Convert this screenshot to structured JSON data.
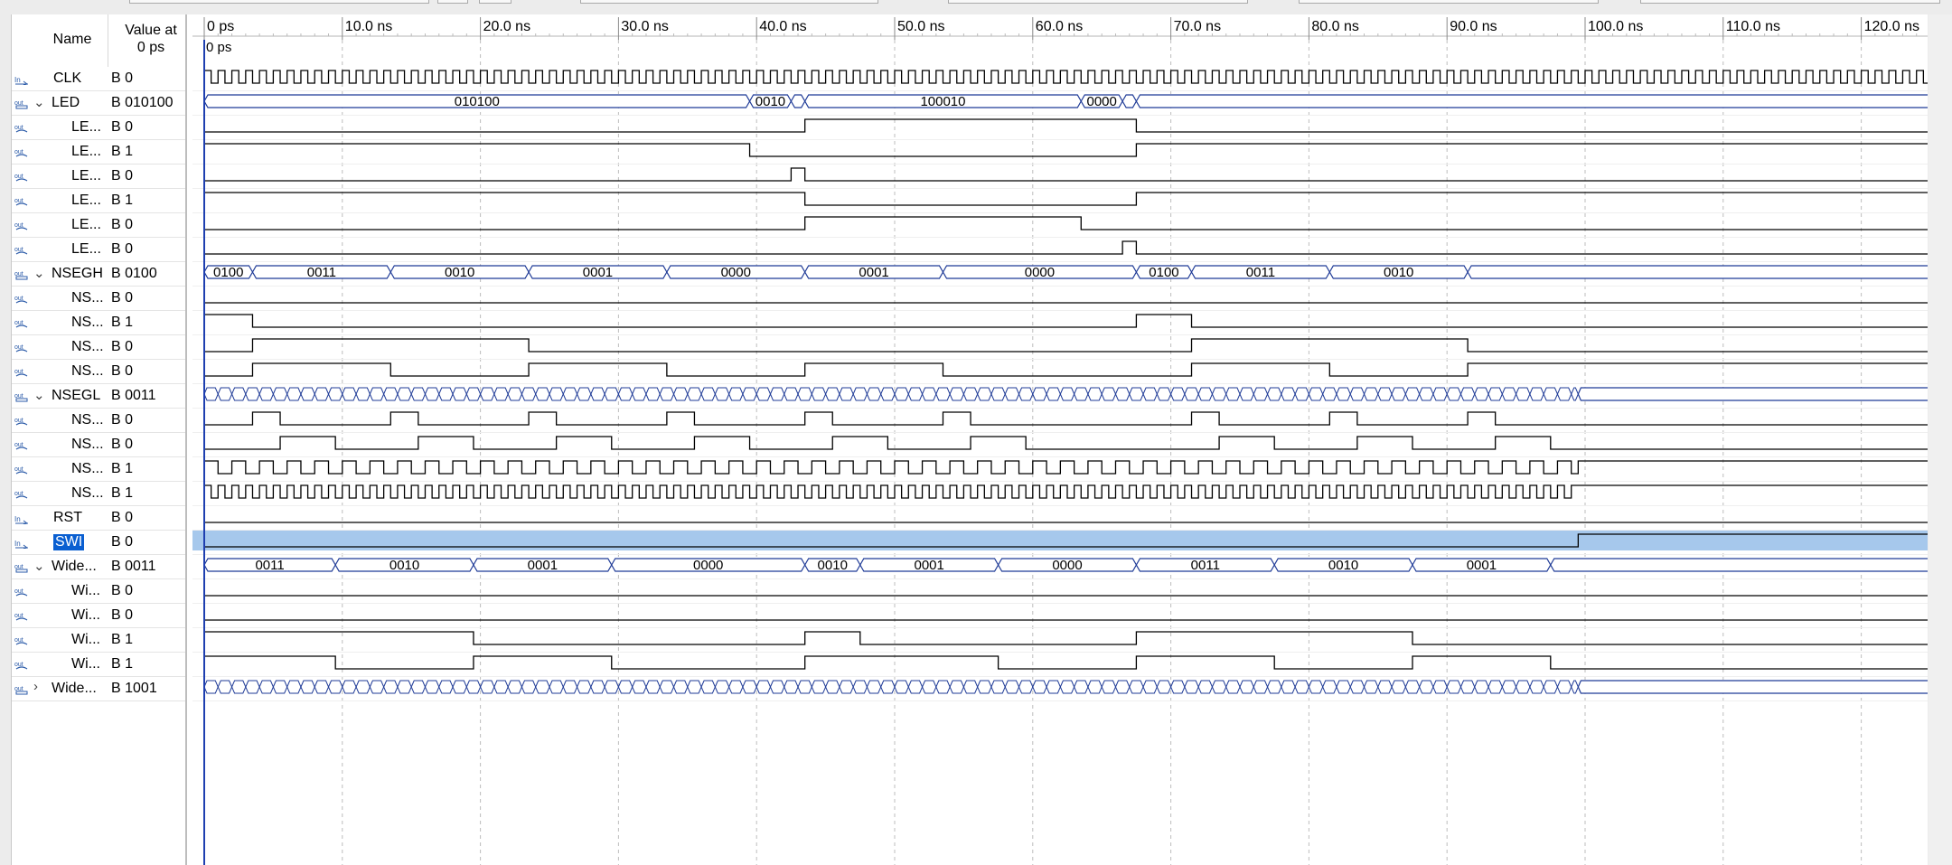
{
  "header": {
    "name_label": "Name",
    "value_label_line1": "Value at",
    "value_label_line2": "0 ps"
  },
  "time_axis": {
    "labels": [
      "0 ps",
      "10.0 ns",
      "20.0 ns",
      "30.0 ns",
      "40.0 ns",
      "50.0 ns",
      "60.0 ns",
      "70.0 ns",
      "80.0 ns",
      "90.0 ns",
      "100.0 ns",
      "110.0 ns",
      "120.0 ns"
    ],
    "cursor_label": "0 ps"
  },
  "signals": [
    {
      "name": "CLK",
      "value": "B 0",
      "icon": "input-icon",
      "expand": "",
      "indent": 0,
      "kind": "clock",
      "period": 1
    },
    {
      "name": "LED",
      "value": "B 010100",
      "icon": "bus-icon",
      "expand": "expanded",
      "indent": 0,
      "kind": "bus",
      "segments": [
        [
          0,
          39.5,
          "010100"
        ],
        [
          39.5,
          42.5,
          "0010"
        ],
        [
          42.5,
          43.5,
          ""
        ],
        [
          43.5,
          63.5,
          "100010"
        ],
        [
          63.5,
          66.5,
          "0000"
        ],
        [
          66.5,
          67.5,
          ""
        ],
        [
          67.5,
          125,
          ""
        ]
      ]
    },
    {
      "name": "LE...",
      "value": "B 0",
      "icon": "output-icon",
      "expand": "",
      "indent": 1,
      "kind": "bit",
      "initial": 0,
      "edges": [
        43.5,
        67.5
      ]
    },
    {
      "name": "LE...",
      "value": "B 1",
      "icon": "output-icon",
      "expand": "",
      "indent": 1,
      "kind": "bit",
      "initial": 1,
      "edges": [
        39.5,
        67.5
      ]
    },
    {
      "name": "LE...",
      "value": "B 0",
      "icon": "output-icon",
      "expand": "",
      "indent": 1,
      "kind": "bit",
      "initial": 0,
      "edges": [
        42.5,
        43.5
      ]
    },
    {
      "name": "LE...",
      "value": "B 1",
      "icon": "output-icon",
      "expand": "",
      "indent": 1,
      "kind": "bit",
      "initial": 1,
      "edges": [
        43.5,
        67.5
      ]
    },
    {
      "name": "LE...",
      "value": "B 0",
      "icon": "output-icon",
      "expand": "",
      "indent": 1,
      "kind": "bit",
      "initial": 0,
      "edges": [
        43.5,
        63.5
      ]
    },
    {
      "name": "LE...",
      "value": "B 0",
      "icon": "output-icon",
      "expand": "",
      "indent": 1,
      "kind": "bit",
      "initial": 0,
      "edges": [
        66.5,
        67.5
      ]
    },
    {
      "name": "NSEGH",
      "value": "B 0100",
      "icon": "bus-icon",
      "expand": "expanded",
      "indent": 0,
      "kind": "bus",
      "segments": [
        [
          0,
          3.5,
          "0100"
        ],
        [
          3.5,
          13.5,
          "0011"
        ],
        [
          13.5,
          23.5,
          "0010"
        ],
        [
          23.5,
          33.5,
          "0001"
        ],
        [
          33.5,
          43.5,
          "0000"
        ],
        [
          43.5,
          53.5,
          "0001"
        ],
        [
          53.5,
          67.5,
          "0000"
        ],
        [
          67.5,
          71.5,
          "0100"
        ],
        [
          71.5,
          81.5,
          "0011"
        ],
        [
          81.5,
          91.5,
          "0010"
        ],
        [
          91.5,
          125,
          ""
        ]
      ]
    },
    {
      "name": "NS...",
      "value": "B 0",
      "icon": "output-icon",
      "expand": "",
      "indent": 1,
      "kind": "bit",
      "initial": 0,
      "edges": []
    },
    {
      "name": "NS...",
      "value": "B 1",
      "icon": "output-icon",
      "expand": "",
      "indent": 1,
      "kind": "bit",
      "initial": 1,
      "edges": [
        3.5,
        67.5,
        71.5
      ]
    },
    {
      "name": "NS...",
      "value": "B 0",
      "icon": "output-icon",
      "expand": "",
      "indent": 1,
      "kind": "bit",
      "initial": 0,
      "edges": [
        3.5,
        23.5,
        71.5,
        91.5
      ]
    },
    {
      "name": "NS...",
      "value": "B 0",
      "icon": "output-icon",
      "expand": "",
      "indent": 1,
      "kind": "bit",
      "initial": 0,
      "edges": [
        3.5,
        13.5,
        23.5,
        33.5,
        43.5,
        53.5,
        71.5,
        81.5,
        91.5
      ]
    },
    {
      "name": "NSEGL",
      "value": "B 0011",
      "icon": "bus-icon",
      "expand": "expanded",
      "indent": 0,
      "kind": "dense",
      "end": 99.5,
      "period": 1
    },
    {
      "name": "NS...",
      "value": "B 0",
      "icon": "output-icon",
      "expand": "",
      "indent": 1,
      "kind": "bit",
      "initial": 0,
      "edges": [
        3.5,
        5.5,
        13.5,
        15.5,
        23.5,
        25.5,
        33.5,
        35.5,
        43.5,
        45.5,
        53.5,
        55.5,
        71.5,
        73.5,
        81.5,
        83.5,
        91.5,
        93.5
      ]
    },
    {
      "name": "NS...",
      "value": "B 0",
      "icon": "output-icon",
      "expand": "",
      "indent": 1,
      "kind": "bit",
      "initial": 0,
      "edges": [
        5.5,
        9.5,
        15.5,
        19.5,
        25.5,
        29.5,
        35.5,
        39.5,
        45.5,
        49.5,
        55.5,
        59.5,
        73.5,
        77.5,
        83.5,
        87.5,
        93.5,
        97.5
      ]
    },
    {
      "name": "NS...",
      "value": "B 1",
      "icon": "output-icon",
      "expand": "",
      "indent": 1,
      "kind": "periodic",
      "initial": 1,
      "period": 2,
      "end": 99.5
    },
    {
      "name": "NS...",
      "value": "B 1",
      "icon": "output-icon",
      "expand": "",
      "indent": 1,
      "kind": "periodic",
      "initial": 1,
      "period": 1,
      "end": 99.5
    },
    {
      "name": "RST",
      "value": "B 0",
      "icon": "input-icon",
      "expand": "",
      "indent": 0,
      "kind": "bit",
      "initial": 0,
      "edges": []
    },
    {
      "name": "SWI",
      "value": "B 0",
      "icon": "input-icon",
      "expand": "",
      "indent": 0,
      "kind": "bit",
      "initial": 0,
      "edges": [
        99.5
      ],
      "selected": true
    },
    {
      "name": "Wide...",
      "value": "B 0011",
      "icon": "bus-icon",
      "expand": "expanded",
      "indent": 0,
      "kind": "bus",
      "segments": [
        [
          0,
          9.5,
          "0011"
        ],
        [
          9.5,
          19.5,
          "0010"
        ],
        [
          19.5,
          29.5,
          "0001"
        ],
        [
          29.5,
          43.5,
          "0000"
        ],
        [
          43.5,
          47.5,
          "0010"
        ],
        [
          47.5,
          57.5,
          "0001"
        ],
        [
          57.5,
          67.5,
          "0000"
        ],
        [
          67.5,
          77.5,
          "0011"
        ],
        [
          77.5,
          87.5,
          "0010"
        ],
        [
          87.5,
          97.5,
          "0001"
        ],
        [
          97.5,
          125,
          ""
        ]
      ]
    },
    {
      "name": "Wi...",
      "value": "B 0",
      "icon": "output-icon",
      "expand": "",
      "indent": 1,
      "kind": "bit",
      "initial": 0,
      "edges": []
    },
    {
      "name": "Wi...",
      "value": "B 0",
      "icon": "output-icon",
      "expand": "",
      "indent": 1,
      "kind": "bit",
      "initial": 0,
      "edges": []
    },
    {
      "name": "Wi...",
      "value": "B 1",
      "icon": "output-icon",
      "expand": "",
      "indent": 1,
      "kind": "bit",
      "initial": 1,
      "edges": [
        19.5,
        43.5,
        47.5,
        67.5,
        87.5
      ]
    },
    {
      "name": "Wi...",
      "value": "B 1",
      "icon": "output-icon",
      "expand": "",
      "indent": 1,
      "kind": "bit",
      "initial": 1,
      "edges": [
        9.5,
        19.5,
        29.5,
        43.5,
        57.5,
        67.5,
        77.5,
        87.5,
        97.5
      ]
    },
    {
      "name": "Wide...",
      "value": "B 1001",
      "icon": "bus-icon",
      "expand": "collapsed",
      "indent": 0,
      "kind": "dense",
      "end": 99.5,
      "period": 1
    }
  ],
  "colors": {
    "wave": "#000000",
    "bus": "#1f3b97",
    "grid": "#bdbdbd",
    "cursor": "#1e3fb0",
    "selected_row": "#a6c8ec",
    "selected_name": "#0a5fd1"
  }
}
